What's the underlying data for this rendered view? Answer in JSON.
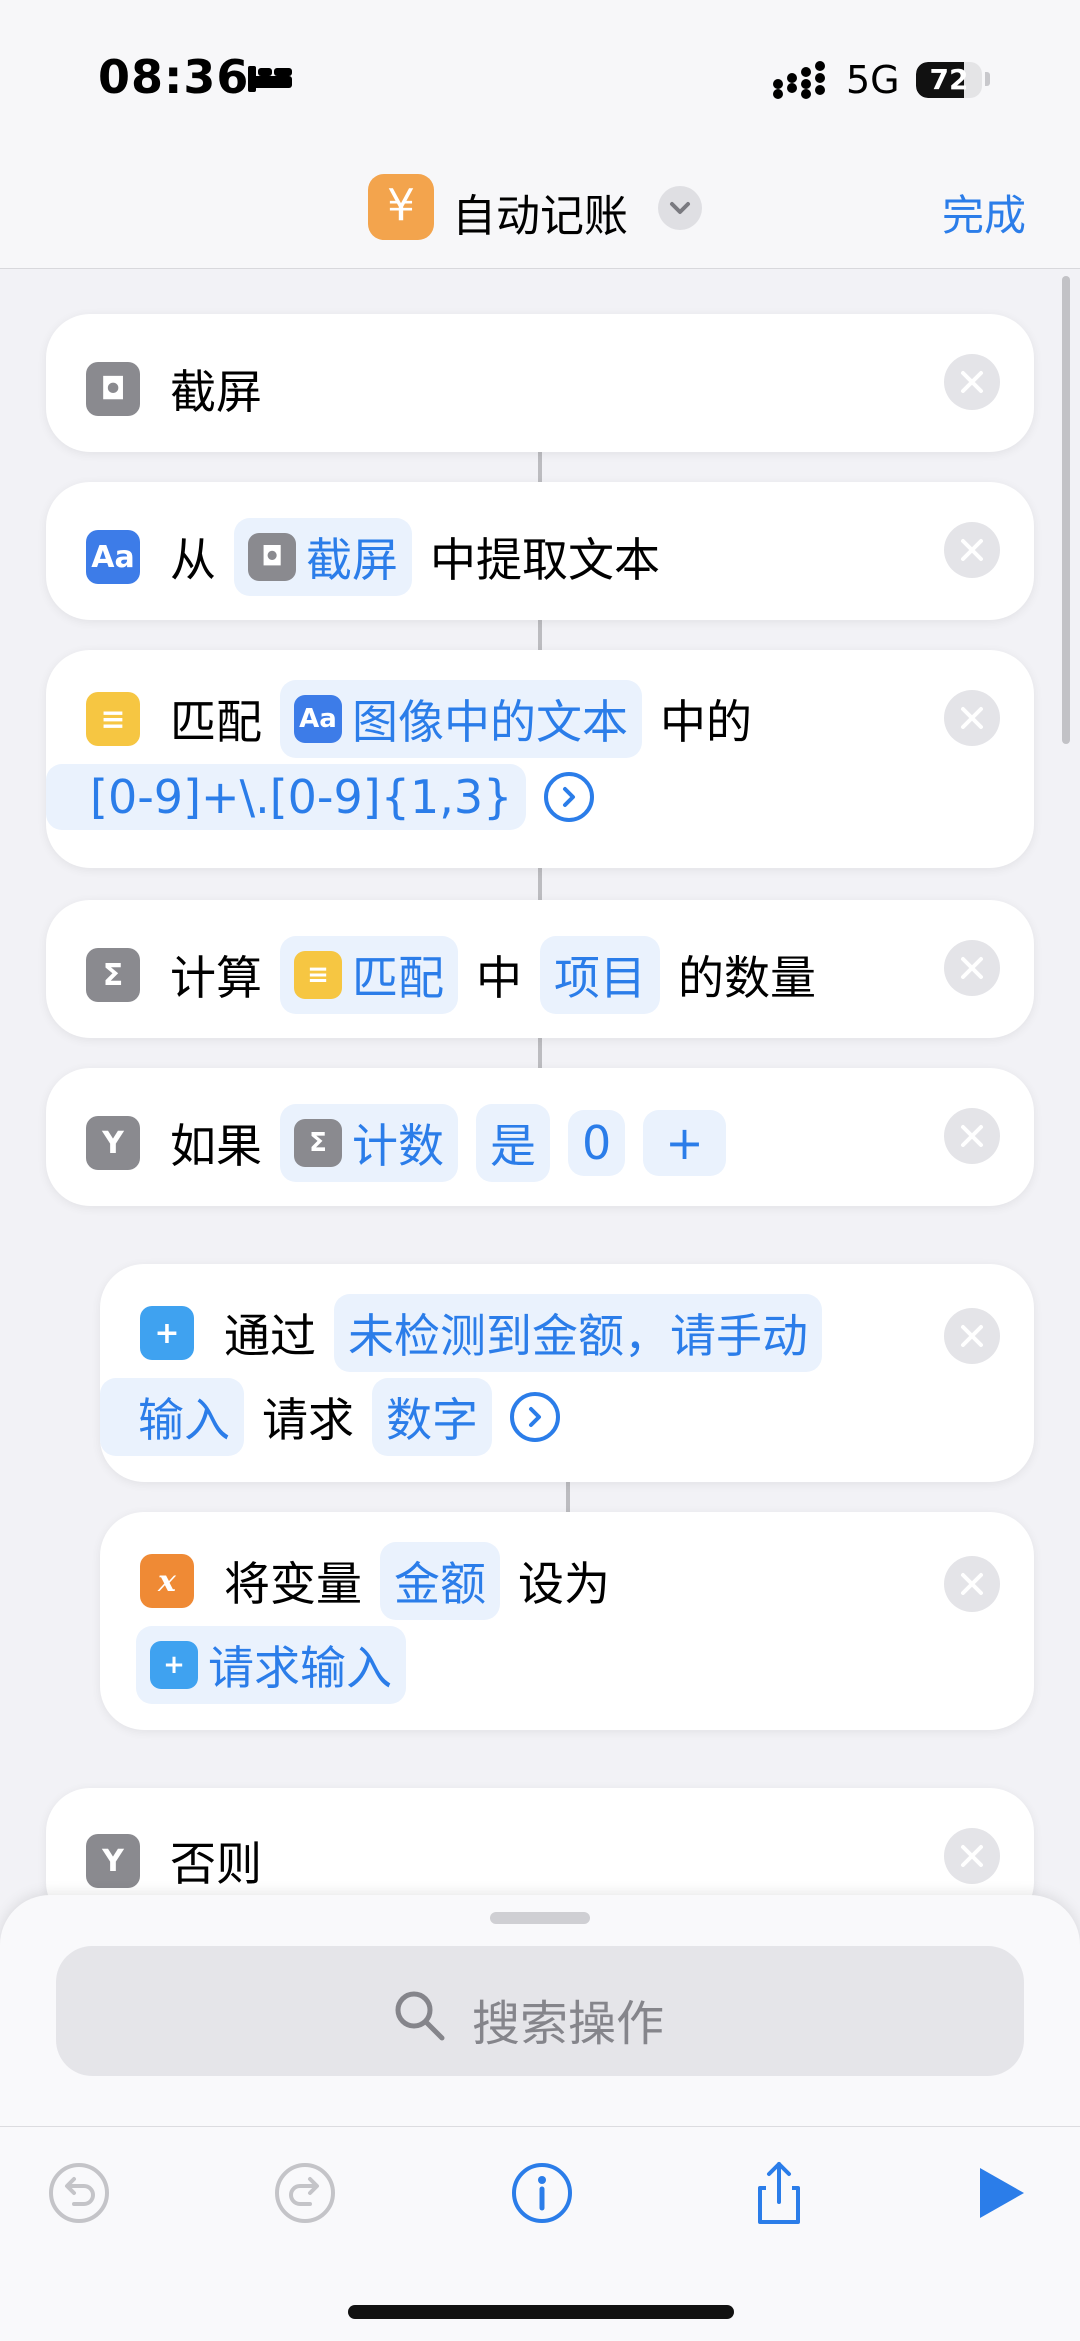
{
  "status_bar": {
    "time": "08:36",
    "network": "5G",
    "battery": "72",
    "battery_level": 0.72
  },
  "nav": {
    "app_icon_glyph": "¥",
    "title": "自动记账",
    "done": "完成"
  },
  "actions": {
    "screenshot": {
      "label": "截屏"
    },
    "extract": {
      "from": "从",
      "token": "截屏",
      "rest": "中提取文本"
    },
    "match": {
      "label": "匹配",
      "token": "图像中的文本",
      "mid": "中的",
      "pattern": "[0-9]+\\.[0-9]{1,3}"
    },
    "count": {
      "label": "计算",
      "token": "匹配",
      "mid": "中",
      "token2": "项目",
      "rest": "的数量"
    },
    "if": {
      "label": "如果",
      "token": "计数",
      "op": "是",
      "value": "0",
      "plus": "+"
    },
    "ask": {
      "label": "通过",
      "token_line1": "未检测到金额，请手动",
      "token_line2": "输入",
      "mid": "请求",
      "type": "数字"
    },
    "setvar": {
      "label": "将变量",
      "token": "金额",
      "mid": "设为",
      "value": "请求输入"
    },
    "otherwise": {
      "label": "否则"
    }
  },
  "search": {
    "placeholder": "搜索操作"
  },
  "toolbar": {
    "undo": "undo-icon",
    "redo": "redo-icon",
    "info": "info-icon",
    "share": "share-icon",
    "run": "play-icon"
  },
  "colors": {
    "accent": "#2b7de9",
    "app_icon": "#f3a44d"
  }
}
